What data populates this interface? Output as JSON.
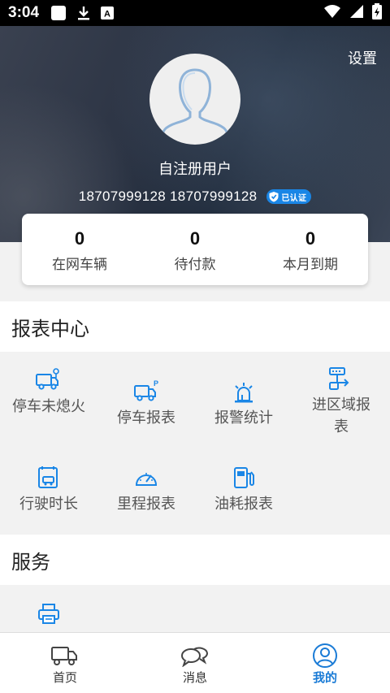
{
  "status_bar": {
    "time": "3:04"
  },
  "header": {
    "settings": "设置",
    "username": "自注册用户",
    "phone": "18707999128 18707999128",
    "verified_badge": "已认证"
  },
  "stats": [
    {
      "value": "0",
      "label": "在网车辆"
    },
    {
      "value": "0",
      "label": "待付款"
    },
    {
      "value": "0",
      "label": "本月到期"
    }
  ],
  "report_center": {
    "title": "报表中心",
    "items": [
      {
        "label": "停车未熄火",
        "icon": "truck-key-icon"
      },
      {
        "label": "停车报表",
        "icon": "truck-parking-icon"
      },
      {
        "label": "报警统计",
        "icon": "alarm-light-icon"
      },
      {
        "label": "进区域报表",
        "icon": "area-route-icon"
      },
      {
        "label": "行驶时长",
        "icon": "driving-time-icon"
      },
      {
        "label": "里程报表",
        "icon": "speedometer-icon"
      },
      {
        "label": "油耗报表",
        "icon": "fuel-pump-icon"
      }
    ]
  },
  "services": {
    "title": "服务",
    "items": [
      {
        "label": "",
        "icon": "printer-icon"
      }
    ]
  },
  "tabs": [
    {
      "label": "首页",
      "icon": "truck-icon",
      "active": false
    },
    {
      "label": "消息",
      "icon": "chat-icon",
      "active": false
    },
    {
      "label": "我的",
      "icon": "user-icon",
      "active": true
    }
  ],
  "colors": {
    "accent": "#1a86e6",
    "active_tab": "#1a7bd6",
    "header_bg": "#2d3545"
  }
}
